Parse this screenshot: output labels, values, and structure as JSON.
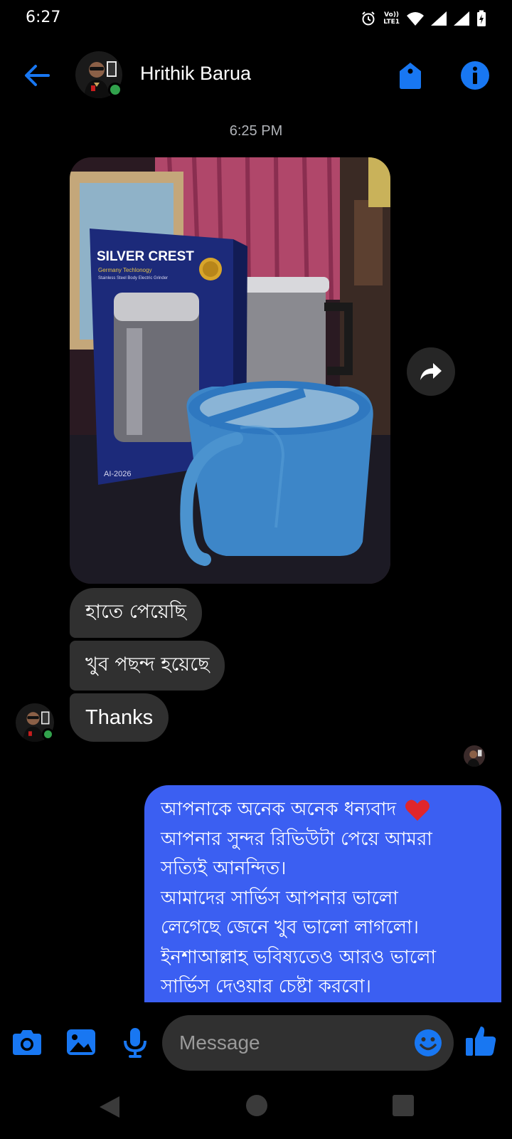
{
  "status_bar": {
    "time": "6:27",
    "volte_top": "Vo))",
    "volte_bottom": "LTE1"
  },
  "header": {
    "contact_name": "Hrithik Barua",
    "accent_color": "#1877f2",
    "online_color": "#31a24c"
  },
  "conversation": {
    "timestamp": "6:25 PM",
    "photo": {
      "box_brand": "SILVER CREST",
      "box_tagline": "Germany Techlonogy",
      "box_subtitle": "Stainless Steel Body Electric Grinder",
      "box_model": "AI-2026"
    },
    "incoming": [
      {
        "text": "হাতে পেয়েছি"
      },
      {
        "text": "খুব পছন্দ হয়েছে"
      },
      {
        "text": "Thanks"
      }
    ],
    "outgoing": {
      "bubble_color": "#3b5ff2",
      "lines": [
        "আপনাকে অনেক অনেক ধন্যবাদ",
        "আপনার সুন্দর রিভিউটা পেয়ে আমরা",
        "সত্যিই আনন্দিত।",
        "আমাদের সার্ভিস আপনার ভালো",
        "লেগেছে জেনে খুব ভালো লাগলো।",
        "ইনশাআল্লাহ ভবিষ্যতেও আরও ভালো",
        "সার্ভিস দেওয়ার চেষ্টা করবো।"
      ]
    }
  },
  "composer": {
    "placeholder": "Message"
  },
  "icons": {
    "back": "arrow-left-icon",
    "tag": "tag-icon",
    "info": "info-icon",
    "share": "share-arrow-icon",
    "camera": "camera-icon",
    "gallery": "image-icon",
    "mic": "microphone-icon",
    "emoji": "smiley-icon",
    "like": "thumbs-up-icon"
  }
}
